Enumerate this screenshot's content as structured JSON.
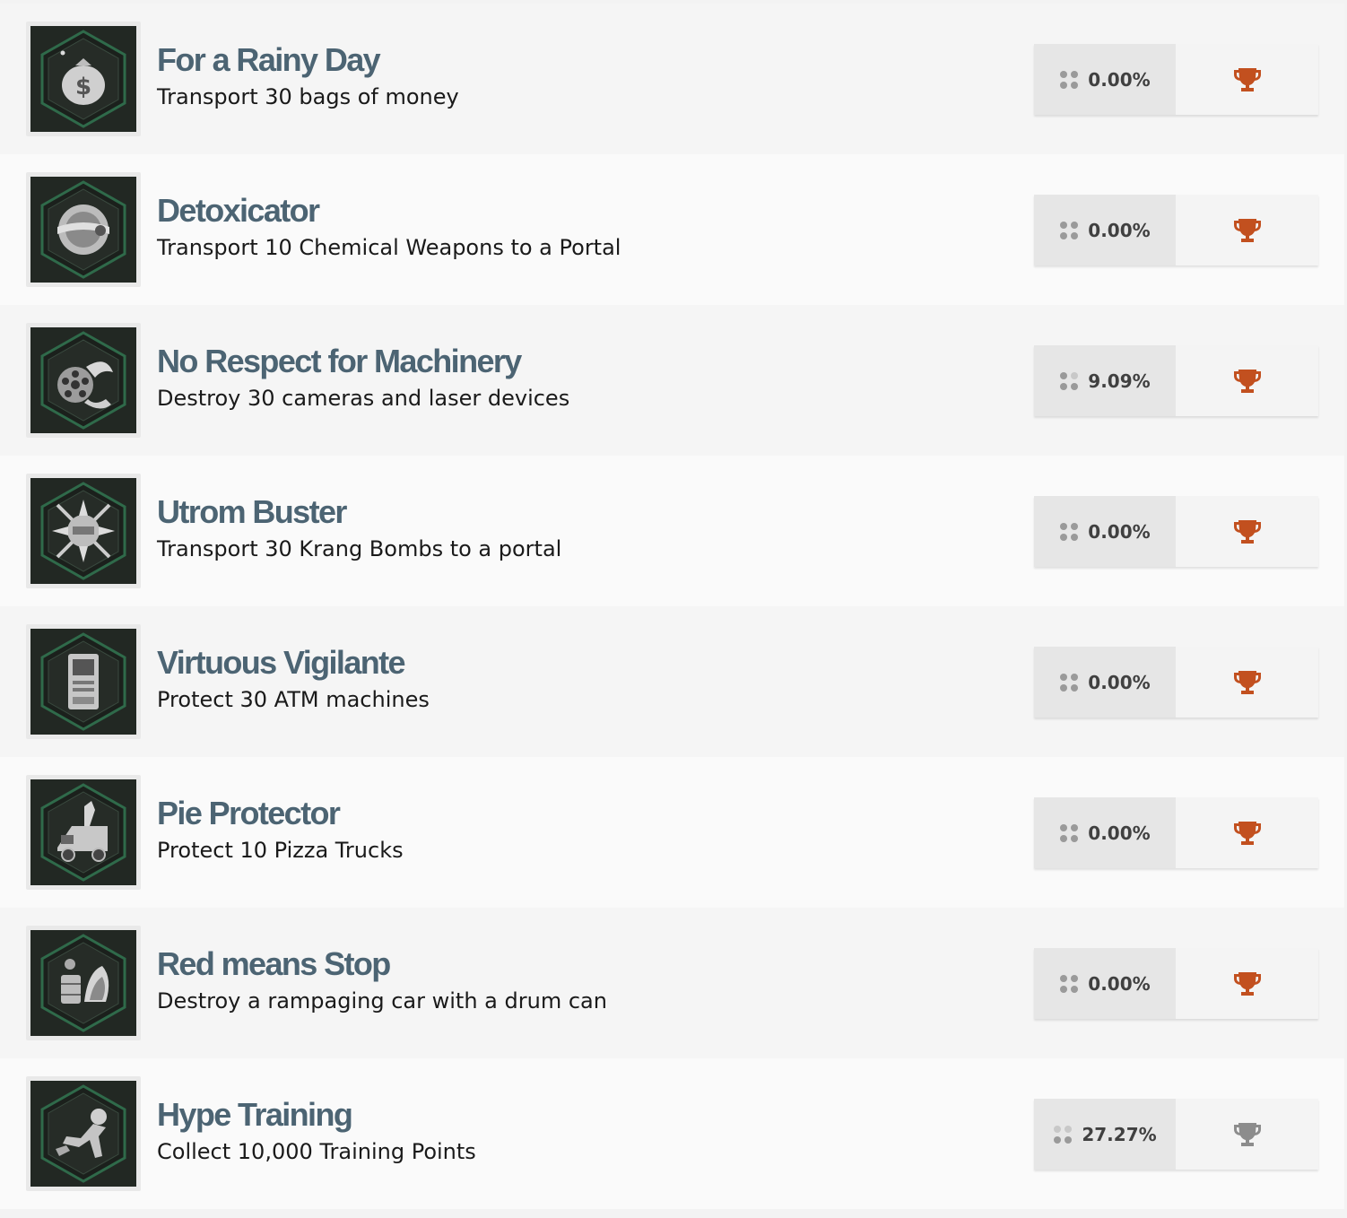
{
  "achievements": [
    {
      "title": "For a Rainy Day",
      "description": "Transport 30 bags of money",
      "percent": "0.00%",
      "icon": "money-bag-icon",
      "trophy": "bronze-trophy-icon",
      "trophy_color": "#c2501f"
    },
    {
      "title": "Detoxicator",
      "description": "Transport 10 Chemical Weapons to a Portal",
      "percent": "0.00%",
      "icon": "chemical-weapon-icon",
      "trophy": "bronze-trophy-icon",
      "trophy_color": "#c2501f"
    },
    {
      "title": "No Respect for Machinery",
      "description": "Destroy 30 cameras and laser devices",
      "percent": "9.09%",
      "icon": "gatling-laser-icon",
      "trophy": "bronze-trophy-icon",
      "trophy_color": "#c2501f"
    },
    {
      "title": "Utrom Buster",
      "description": "Transport 30 Krang Bombs to a portal",
      "percent": "0.00%",
      "icon": "krang-bomb-icon",
      "trophy": "bronze-trophy-icon",
      "trophy_color": "#c2501f"
    },
    {
      "title": "Virtuous Vigilante",
      "description": "Protect 30 ATM machines",
      "percent": "0.00%",
      "icon": "atm-machine-icon",
      "trophy": "bronze-trophy-icon",
      "trophy_color": "#c2501f"
    },
    {
      "title": "Pie Protector",
      "description": "Protect 10 Pizza Trucks",
      "percent": "0.00%",
      "icon": "pizza-truck-icon",
      "trophy": "bronze-trophy-icon",
      "trophy_color": "#c2501f"
    },
    {
      "title": "Red means Stop",
      "description": "Destroy a rampaging car with a drum can",
      "percent": "0.00%",
      "icon": "drum-can-car-icon",
      "trophy": "bronze-trophy-icon",
      "trophy_color": "#c2501f"
    },
    {
      "title": "Hype Training",
      "description": "Collect 10,000 Training Points",
      "percent": "27.27%",
      "icon": "turtle-training-icon",
      "trophy": "silver-trophy-icon",
      "trophy_color": "#8c8c8c"
    }
  ]
}
